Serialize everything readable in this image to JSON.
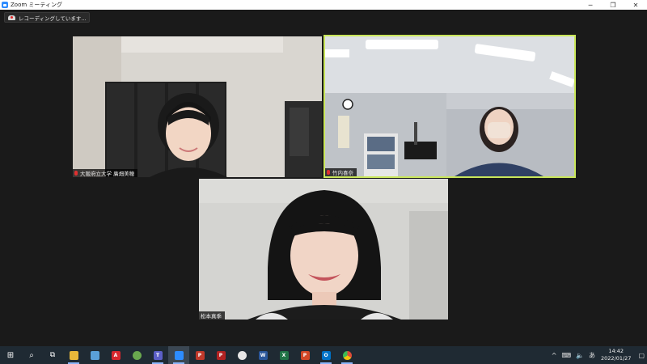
{
  "window": {
    "title": "Zoom ミーティング",
    "minimize_glyph": "─",
    "maximize_glyph": "❐",
    "close_glyph": "✕"
  },
  "recording": {
    "label": "レコーディングしています..."
  },
  "participants": [
    {
      "name": "大阪府立大学 廣畑美穂",
      "muted": true,
      "active_speaker": false
    },
    {
      "name": "竹内喜奈",
      "muted": true,
      "active_speaker": true
    },
    {
      "name": "松本真季",
      "muted": false,
      "active_speaker": false
    }
  ],
  "taskbar": {
    "apps": [
      {
        "icon": "start-windows-icon",
        "label": "⊞",
        "color": "#ffffff"
      },
      {
        "icon": "search-icon",
        "label": "⌕",
        "color": "#ffffff"
      },
      {
        "icon": "task-view-icon",
        "label": "⧉",
        "color": "#ffffff"
      },
      {
        "icon": "file-explorer-icon",
        "label": "",
        "color": "#e8b83a"
      },
      {
        "icon": "notepad-icon",
        "label": "",
        "color": "#5aa0d8"
      },
      {
        "icon": "acrobat-icon",
        "label": "A",
        "color": "#d7272e"
      },
      {
        "icon": "paint-icon",
        "label": "",
        "color": "#6aa84f"
      },
      {
        "icon": "teams-icon",
        "label": "T",
        "color": "#5b5fc7"
      },
      {
        "icon": "zoom-icon",
        "label": "",
        "color": "#2d8cff"
      },
      {
        "icon": "pdf-editor-icon",
        "label": "P",
        "color": "#c0392b"
      },
      {
        "icon": "pdf-viewer-icon",
        "label": "P",
        "color": "#b22222"
      },
      {
        "icon": "obs-icon",
        "label": "",
        "color": "#e6e6e6"
      },
      {
        "icon": "word-icon",
        "label": "W",
        "color": "#2b579a"
      },
      {
        "icon": "excel-icon",
        "label": "X",
        "color": "#217346"
      },
      {
        "icon": "powerpoint-icon",
        "label": "P",
        "color": "#d24726"
      },
      {
        "icon": "outlook-icon",
        "label": "O",
        "color": "#0072c6"
      },
      {
        "icon": "chrome-icon",
        "label": "",
        "color": "#dd4b39"
      }
    ],
    "tray": {
      "chevron": "^",
      "keyboard": "⌨",
      "volume": "🔈",
      "ime": "あ",
      "time": "14:42",
      "date": "2022/01/27",
      "notification": "▢"
    }
  }
}
